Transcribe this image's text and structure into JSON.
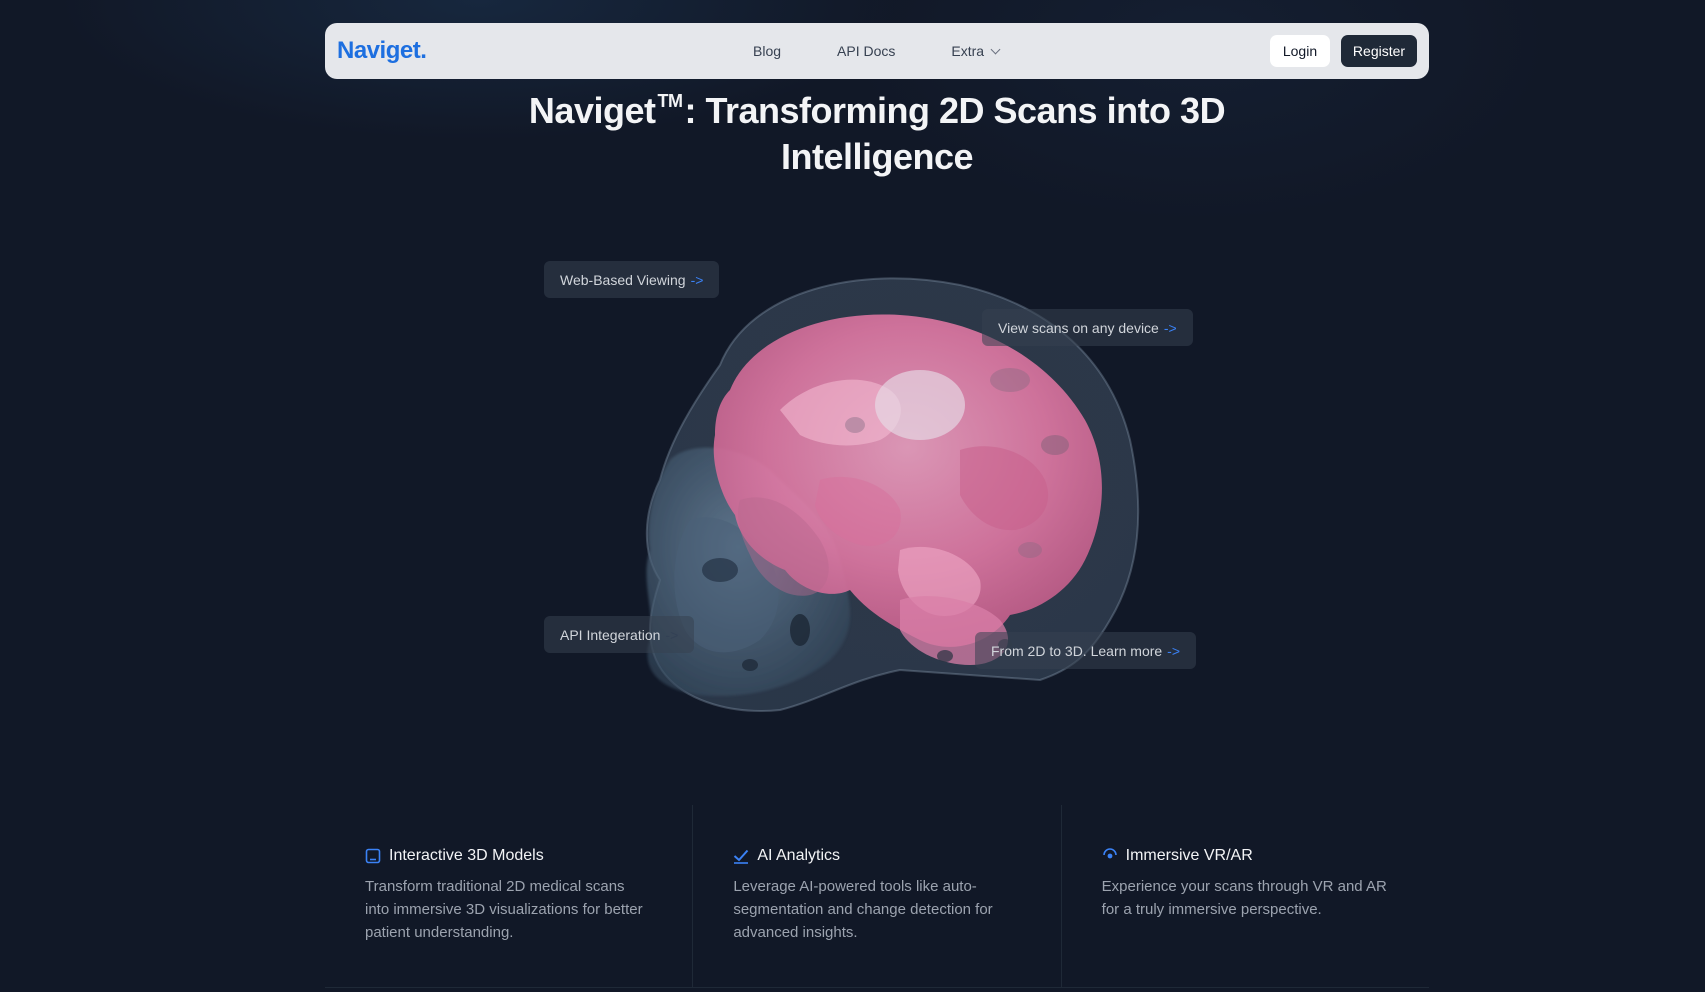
{
  "nav": {
    "logo": "Naviget.",
    "links": [
      "Blog",
      "API Docs",
      "Extra"
    ],
    "login_label": "Login",
    "register_label": "Register"
  },
  "hero": {
    "title_part1": "Naviget",
    "trademark": "TM",
    "title_part2": ": Transforming 2D Scans into 3D Intelligence"
  },
  "callouts": {
    "web_viewing": "Web-Based Viewing",
    "any_device": "View scans on any device",
    "api": "API Integeration",
    "learn_more": "From 2D to 3D. Learn more",
    "arrow": "->"
  },
  "features": [
    {
      "icon": "tablet-icon",
      "title": "Interactive 3D Models",
      "description": "Transform traditional 2D medical scans into immersive 3D visualizations for better patient understanding."
    },
    {
      "icon": "check-icon",
      "title": "AI Analytics",
      "description": "Leverage AI-powered tools like auto-segmentation and change detection for advanced insights."
    },
    {
      "icon": "vr-icon",
      "title": "Immersive VR/AR",
      "description": "Experience your scans through VR and AR for a truly immersive perspective."
    }
  ],
  "colors": {
    "background": "#111827",
    "brand": "#1d6fe0",
    "accent": "#3b82f6",
    "brain": "#e87aa8"
  }
}
